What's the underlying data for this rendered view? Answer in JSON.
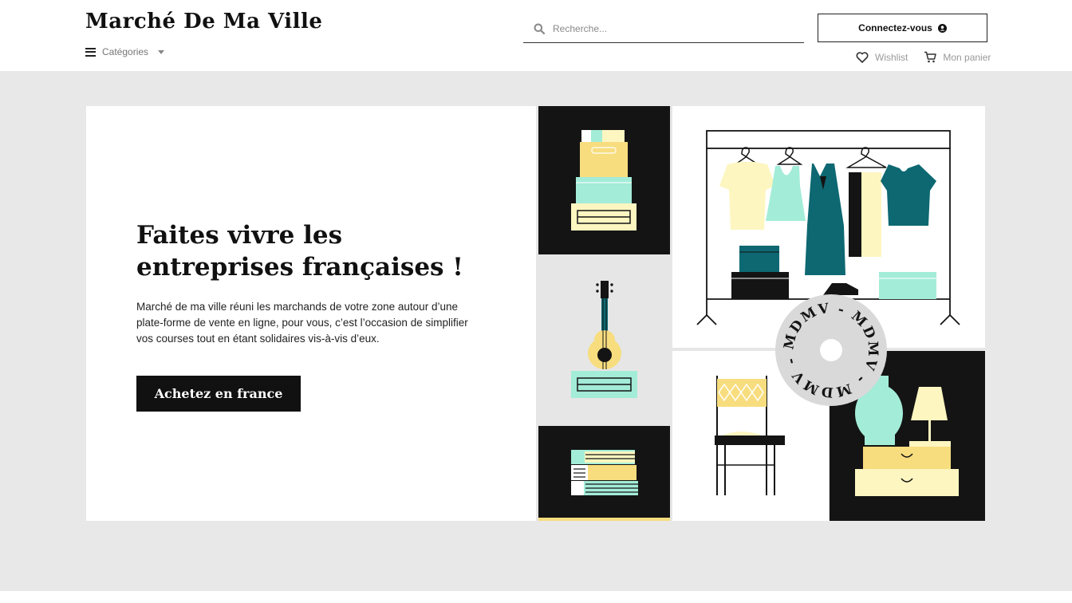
{
  "header": {
    "logo": "Marché De Ma Ville",
    "categories_label": "Catégories",
    "search_placeholder": "Recherche...",
    "login_label": "Connectez-vous",
    "wishlist_label": "Wishlist",
    "cart_label": "Mon panier"
  },
  "hero": {
    "title_line1": "Faites vivre les",
    "title_line2": "entreprises françaises !",
    "description": "Marché de ma ville réuni les marchands de votre zone autour d’une plate-forme de vente en ligne, pour vous, c’est l’occasion de simplifier vos courses tout en étant solidaires vis-à-vis d’eux.",
    "cta_label": "Achetez en france"
  },
  "badge": {
    "text": "MDMV"
  },
  "colors": {
    "dark": "#141414",
    "teal": "#0d6872",
    "mint": "#a3ecd8",
    "yellow": "#f7dd7e",
    "cream": "#fdf6c0",
    "grey_bg": "#e8e8e8"
  }
}
